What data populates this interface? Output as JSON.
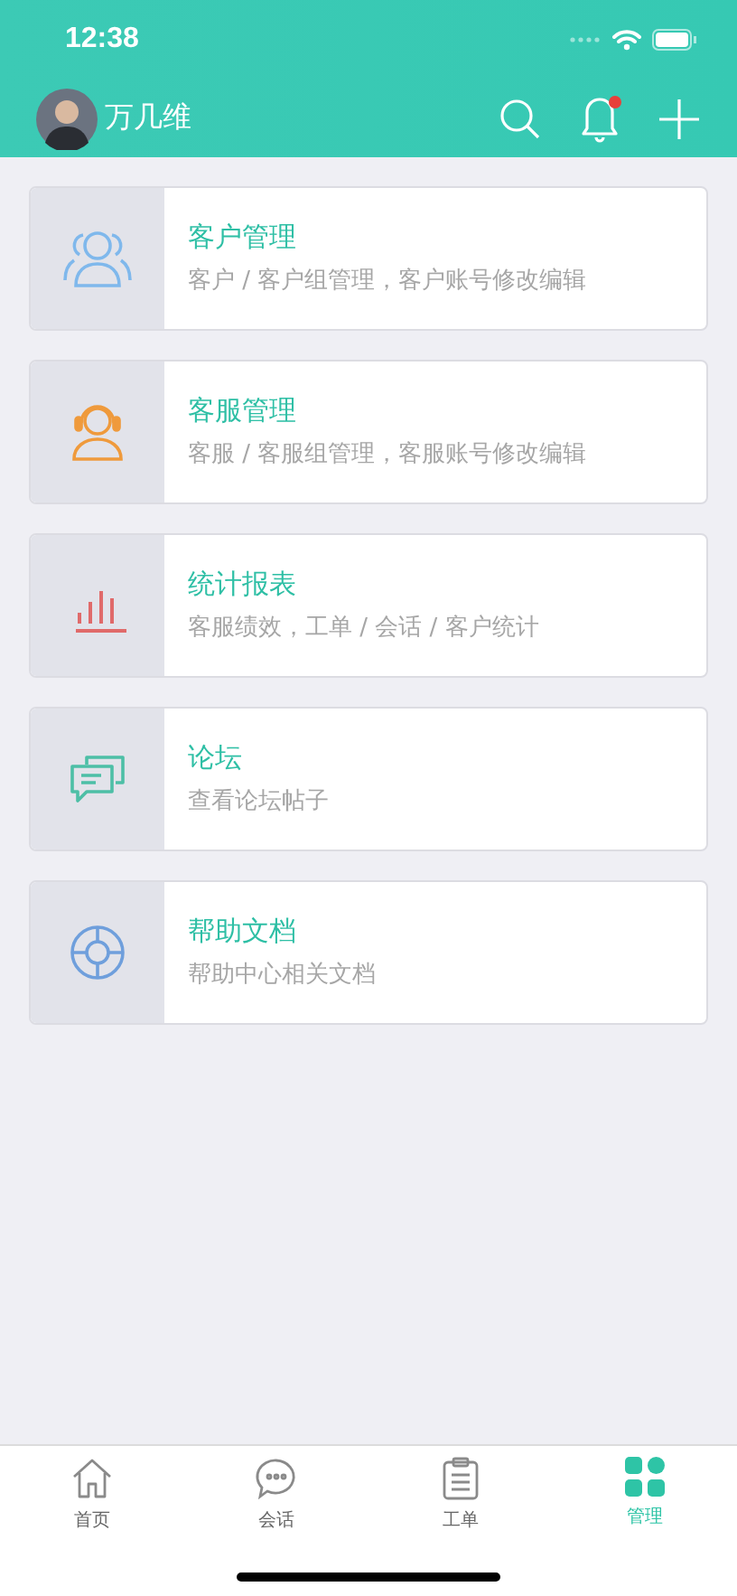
{
  "status_bar": {
    "time": "12:38"
  },
  "header": {
    "user_name": "万几维",
    "notification_dot": true
  },
  "modules": [
    {
      "kind": "customers",
      "title": "客户管理",
      "description": "客户 / 客户组管理，客户账号修改编辑"
    },
    {
      "kind": "agents",
      "title": "客服管理",
      "description": "客服 / 客服组管理，客服账号修改编辑"
    },
    {
      "kind": "stats",
      "title": "统计报表",
      "description": "客服绩效，工单 / 会话 / 客户统计"
    },
    {
      "kind": "forum",
      "title": "论坛",
      "description": "查看论坛帖子"
    },
    {
      "kind": "help",
      "title": "帮助文档",
      "description": "帮助中心相关文档"
    }
  ],
  "tabs": [
    {
      "kind": "home",
      "label": "首页",
      "selected": false
    },
    {
      "kind": "chat",
      "label": "会话",
      "selected": false
    },
    {
      "kind": "ticket",
      "label": "工单",
      "selected": false
    },
    {
      "kind": "manage",
      "label": "管理",
      "selected": true
    }
  ]
}
